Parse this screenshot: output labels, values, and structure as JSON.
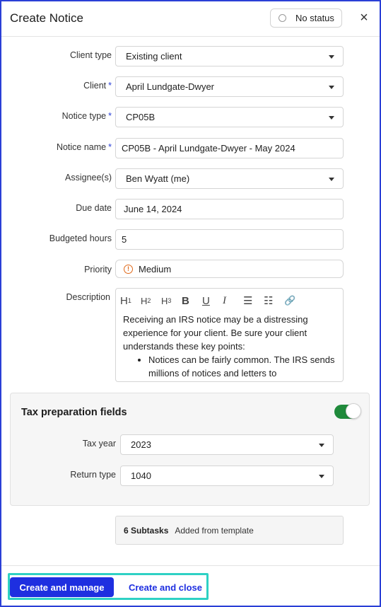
{
  "header": {
    "title": "Create Notice",
    "status_label": "No status",
    "close_glyph": "×"
  },
  "form": {
    "client_type": {
      "label": "Client type",
      "value": "Existing client"
    },
    "client": {
      "label": "Client",
      "required": "*",
      "value": "April Lundgate-Dwyer"
    },
    "notice_type": {
      "label": "Notice type",
      "required": "*",
      "value": "CP05B"
    },
    "notice_name": {
      "label": "Notice name",
      "required": "*",
      "value": "CP05B - April Lundgate-Dwyer - May 2024"
    },
    "assignees": {
      "label": "Assignee(s)",
      "value": "Ben Wyatt (me)"
    },
    "due_date": {
      "label": "Due date",
      "value": "June 14, 2024"
    },
    "budgeted_hours": {
      "label": "Budgeted hours",
      "value": "5"
    },
    "priority": {
      "label": "Priority",
      "value": "Medium",
      "icon": "warning-circle-icon",
      "icon_glyph": "!",
      "color": "#e06a1b"
    },
    "description": {
      "label": "Description",
      "toolbar": {
        "h1": "H",
        "h1_sub": "1",
        "h2": "H",
        "h2_sub": "2",
        "h3": "H",
        "h3_sub": "3",
        "bold": "B",
        "underline": "U",
        "italic": "I",
        "bullet_list": "☰",
        "numbered_list": "☷",
        "link": "🔗"
      },
      "paragraph": "Receiving an IRS notice may be a distressing experience for your client. Be sure your client understands these key points:",
      "bullets": [
        "Notices can be fairly common. The IRS sends millions of notices and letters to"
      ]
    }
  },
  "tax_section": {
    "title": "Tax preparation fields",
    "toggle_on": true,
    "toggle_color": "#1f8a3b",
    "tax_year": {
      "label": "Tax year",
      "value": "2023"
    },
    "return_type": {
      "label": "Return type",
      "value": "1040"
    }
  },
  "subtasks": {
    "count": "6 Subtasks",
    "note": "Added from template"
  },
  "footer": {
    "primary_label": "Create and manage",
    "secondary_label": "Create and close",
    "primary_color": "#1e2fe0",
    "highlight_color": "#2ed1c4"
  }
}
